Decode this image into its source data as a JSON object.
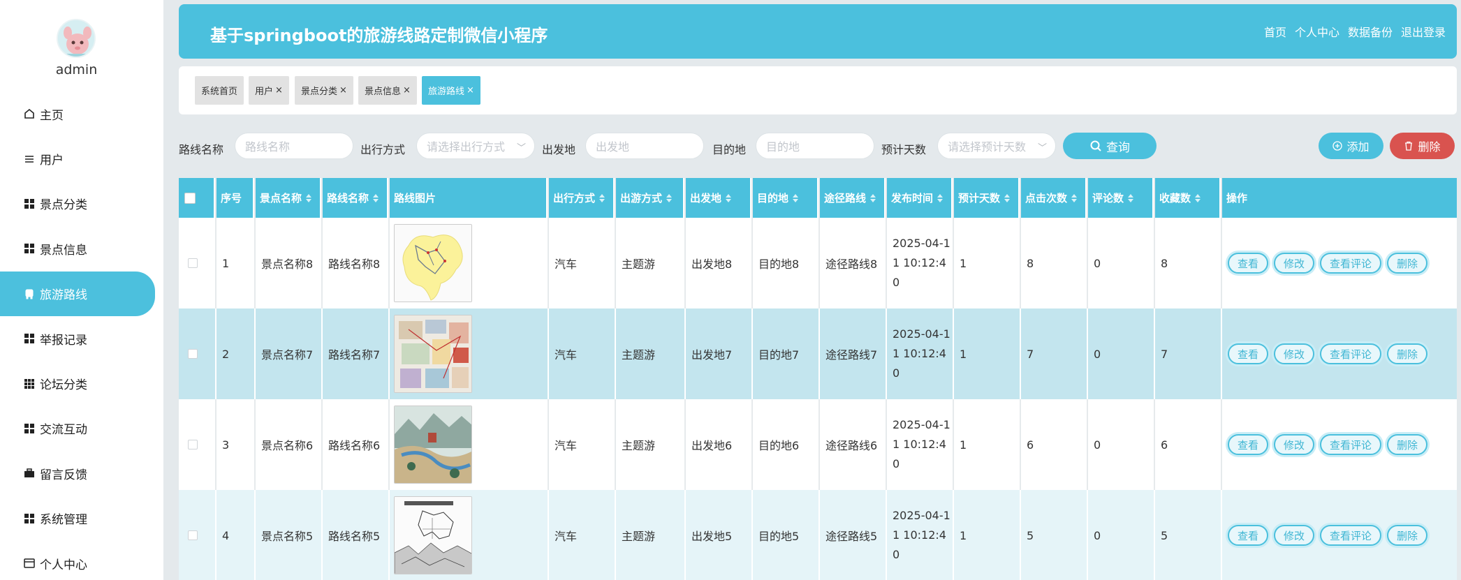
{
  "user": {
    "name": "admin"
  },
  "sidebar": {
    "items": [
      {
        "label": "主页",
        "icon": "home-icon"
      },
      {
        "label": "用户",
        "icon": "list-icon"
      },
      {
        "label": "景点分类",
        "icon": "grid-icon"
      },
      {
        "label": "景点信息",
        "icon": "grid-icon"
      },
      {
        "label": "旅游路线",
        "icon": "bus-icon",
        "active": true
      },
      {
        "label": "举报记录",
        "icon": "grid-icon"
      },
      {
        "label": "论坛分类",
        "icon": "dots-grid-icon"
      },
      {
        "label": "交流互动",
        "icon": "grid-icon"
      },
      {
        "label": "留言反馈",
        "icon": "briefcase-icon"
      },
      {
        "label": "系统管理",
        "icon": "grid-icon"
      },
      {
        "label": "个人中心",
        "icon": "wallet-icon"
      }
    ]
  },
  "header": {
    "title": "基于springboot的旅游线路定制微信小程序",
    "links": [
      "首页",
      "个人中心",
      "数据备份",
      "退出登录"
    ]
  },
  "tabs": [
    {
      "label": "系统首页",
      "closable": false
    },
    {
      "label": "用户",
      "closable": true
    },
    {
      "label": "景点分类",
      "closable": true
    },
    {
      "label": "景点信息",
      "closable": true
    },
    {
      "label": "旅游路线",
      "closable": true,
      "active": true
    }
  ],
  "search": {
    "route_name_label": "路线名称",
    "route_name_placeholder": "路线名称",
    "travel_mode_label": "出行方式",
    "travel_mode_placeholder": "请选择出行方式",
    "departure_label": "出发地",
    "departure_placeholder": "出发地",
    "destination_label": "目的地",
    "destination_placeholder": "目的地",
    "days_label": "预计天数",
    "days_placeholder": "请选择预计天数",
    "query_label": "查询",
    "add_label": "添加",
    "delete_label": "删除"
  },
  "table": {
    "headers": [
      "序号",
      "景点名称",
      "路线名称",
      "路线图片",
      "出行方式",
      "出游方式",
      "出发地",
      "目的地",
      "途径路线",
      "发布时间",
      "预计天数",
      "点击次数",
      "评论数",
      "收藏数",
      "操作"
    ],
    "actions": [
      "查看",
      "修改",
      "查看评论",
      "删除"
    ],
    "rows": [
      {
        "index": "1",
        "spot": "景点名称8",
        "route": "路线名称8",
        "mode": "汽车",
        "tour": "主题游",
        "from": "出发地8",
        "to": "目的地8",
        "via": "途径路线8",
        "time": "2025-04-11 10:12:40",
        "days": "1",
        "clicks": "8",
        "comments": "0",
        "favs": "8",
        "image": "yellow-map"
      },
      {
        "index": "2",
        "spot": "景点名称7",
        "route": "路线名称7",
        "mode": "汽车",
        "tour": "主题游",
        "from": "出发地7",
        "to": "目的地7",
        "via": "途径路线7",
        "time": "2025-04-11 10:12:40",
        "days": "1",
        "clicks": "7",
        "comments": "0",
        "favs": "7",
        "image": "collage-map"
      },
      {
        "index": "3",
        "spot": "景点名称6",
        "route": "路线名称6",
        "mode": "汽车",
        "tour": "主题游",
        "from": "出发地6",
        "to": "目的地6",
        "via": "途径路线6",
        "time": "2025-04-11 10:12:40",
        "days": "1",
        "clicks": "6",
        "comments": "0",
        "favs": "6",
        "image": "illustrated-map"
      },
      {
        "index": "4",
        "spot": "景点名称5",
        "route": "路线名称5",
        "mode": "汽车",
        "tour": "主题游",
        "from": "出发地5",
        "to": "目的地5",
        "via": "途径路线5",
        "time": "2025-04-11 10:12:40",
        "days": "1",
        "clicks": "5",
        "comments": "0",
        "favs": "5",
        "image": "sketch-map"
      }
    ]
  },
  "colors": {
    "accent": "#4bc0dd",
    "danger": "#d9534f",
    "row_alt": "#c3e5ee"
  }
}
